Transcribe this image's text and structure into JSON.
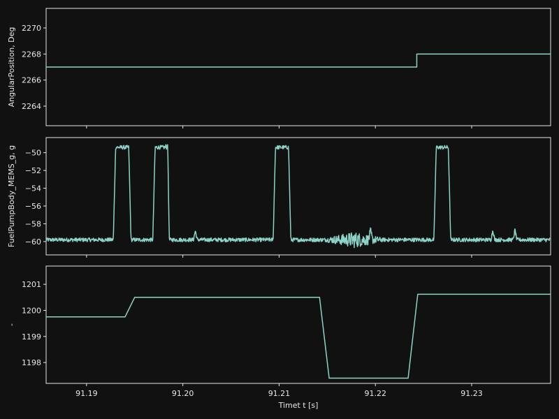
{
  "chart_data": [
    {
      "type": "line",
      "ylabel": "AngularPosition, Deg",
      "xlim": [
        91.1858,
        91.2382
      ],
      "ylim": [
        2262.5,
        2271.5
      ],
      "yticks": [
        2264,
        2266,
        2268,
        2270
      ],
      "xticks": [
        91.19,
        91.2,
        91.21,
        91.22,
        91.23
      ],
      "xtick_labels_visible": false,
      "series": [
        {
          "x": [
            91.1858,
            91.2243,
            91.2243,
            91.2382
          ],
          "y": [
            2267,
            2267,
            2268,
            2268
          ]
        }
      ]
    },
    {
      "type": "line",
      "ylabel": "FuelPumpBody_MEMS_g, g",
      "xlim": [
        91.1858,
        91.2382
      ],
      "ylim": [
        -61.5,
        -48.3
      ],
      "yticks": [
        -60,
        -58,
        -56,
        -54,
        -52,
        -50
      ],
      "xticks": [
        91.19,
        91.2,
        91.21,
        91.22,
        91.23
      ],
      "xtick_labels_visible": false,
      "baseline": -59.8,
      "pulse_level": -49.4,
      "pulses": [
        [
          91.1929,
          91.1945
        ],
        [
          91.197,
          91.1984
        ],
        [
          91.2095,
          91.2111
        ],
        [
          91.2262,
          91.2277
        ]
      ],
      "spikes": [
        [
          91.1984,
          -48.5
        ],
        [
          91.2013,
          -58.8
        ],
        [
          91.2195,
          -58.9
        ],
        [
          91.2322,
          -58.7
        ],
        [
          91.2345,
          -58.7
        ]
      ],
      "noisy_region": [
        91.2148,
        91.2208
      ],
      "series": [
        {
          "name": "",
          "values": []
        }
      ]
    },
    {
      "type": "line",
      "ylabel": "-",
      "xlabel": "Timet t [s]",
      "xlim": [
        91.1858,
        91.2382
      ],
      "ylim": [
        1197.2,
        1201.7
      ],
      "yticks": [
        1198,
        1199,
        1200,
        1201
      ],
      "xticks": [
        91.19,
        91.2,
        91.21,
        91.22,
        91.23
      ],
      "xtick_labels": [
        "91.19",
        "91.20",
        "91.21",
        "91.22",
        "91.23"
      ],
      "series": [
        {
          "x": [
            91.1858,
            91.194,
            91.195,
            91.2142,
            91.2152,
            91.2234,
            91.2244,
            91.2382
          ],
          "y": [
            1199.75,
            1199.75,
            1200.5,
            1200.5,
            1197.4,
            1197.4,
            1200.62,
            1200.62
          ]
        }
      ]
    }
  ],
  "colors": {
    "background": "#111111",
    "axes": "#e8e8e8",
    "line": "#8dd3c7"
  }
}
